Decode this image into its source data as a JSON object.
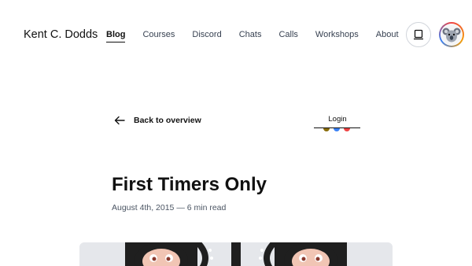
{
  "header": {
    "brand": "Kent C. Dodds",
    "nav": [
      {
        "label": "Blog",
        "active": true
      },
      {
        "label": "Courses"
      },
      {
        "label": "Discord"
      },
      {
        "label": "Chats"
      },
      {
        "label": "Calls"
      },
      {
        "label": "Workshops"
      },
      {
        "label": "About"
      }
    ],
    "icons": {
      "theme": "laptop-icon",
      "avatar": "koala-avatar"
    }
  },
  "article": {
    "back_label": "Back to overview",
    "login_label": "Login",
    "team_colors": [
      "#8a6d0b",
      "#3b82f6",
      "#ef4444"
    ],
    "title": "First Timers Only",
    "meta": "August 4th, 2015 — 6 min read"
  },
  "colors": {
    "accent": "#111111",
    "hero_bg": "#e5e7eb"
  }
}
